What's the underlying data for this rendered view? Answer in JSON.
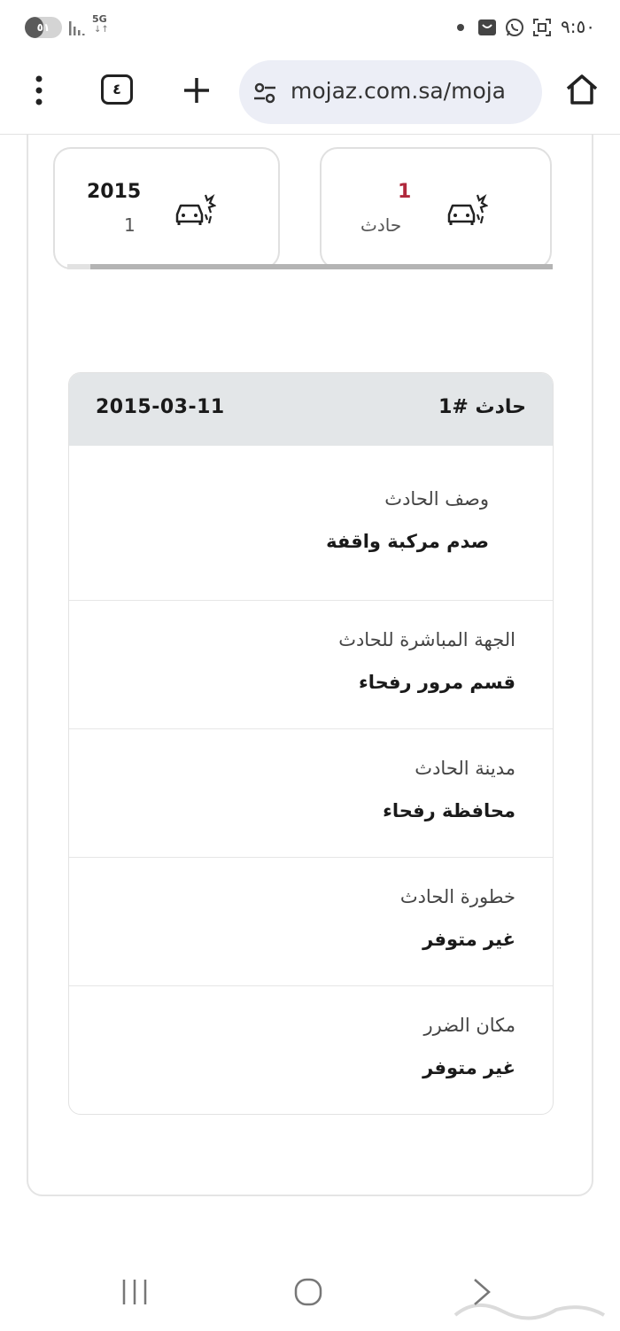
{
  "status_bar": {
    "battery_level": "٥١",
    "network_type": "5G",
    "network_arrows": "↓↑",
    "time": "٩:٥٠",
    "icons": [
      "signal-bars-icon",
      "notification-dot-icon",
      "shopping-bag-icon",
      "whatsapp-icon",
      "screenshot-icon"
    ]
  },
  "browser": {
    "menu_icon": "three-dots-icon",
    "tab_count": "٤",
    "new_tab_icon": "plus-icon",
    "url": "mojaz.com.sa/moja",
    "site_settings_icon": "tune-icon",
    "home_icon": "home-icon"
  },
  "stats": {
    "accidents": {
      "value": "1",
      "label": "حادث",
      "icon": "car-crash-icon"
    },
    "year_card": {
      "year": "2015",
      "count": "1",
      "icon": "car-crash-icon"
    }
  },
  "accident": {
    "title": "حادث #1",
    "date": "2015-03-11",
    "fields": [
      {
        "label": "وصف الحادث",
        "value": "صدم مركبة واقفة"
      },
      {
        "label": "الجهة المباشرة للحادث",
        "value": "قسم مرور رفحاء"
      },
      {
        "label": "مدينة الحادث",
        "value": "محافظة رفحاء"
      },
      {
        "label": "خطورة الحادث",
        "value": "غير متوفر"
      },
      {
        "label": "مكان الضرر",
        "value": "غير متوفر"
      }
    ]
  },
  "nav": {
    "icons": [
      "recent-apps-icon",
      "home-circle-icon",
      "back-chevron-icon"
    ]
  },
  "colors": {
    "accent_red": "#b0283c",
    "header_gray": "#e3e6e8"
  }
}
